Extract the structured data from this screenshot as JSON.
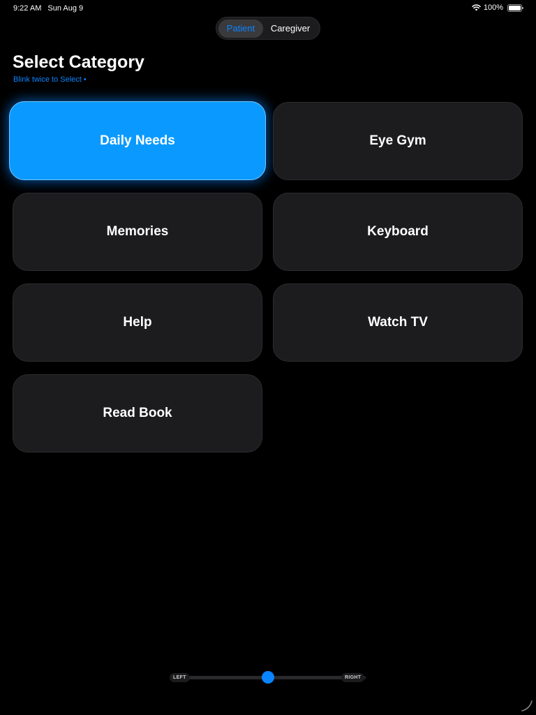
{
  "status_bar": {
    "time": "9:22 AM",
    "date": "Sun Aug 9",
    "battery": "100%"
  },
  "segmented_control": {
    "options": [
      {
        "label": "Patient",
        "selected": true
      },
      {
        "label": "Caregiver",
        "selected": false
      }
    ]
  },
  "header": {
    "title": "Select Category",
    "subtitle": "Blink twice to Select •"
  },
  "categories": [
    {
      "label": "Daily Needs",
      "selected": true
    },
    {
      "label": "Eye Gym",
      "selected": false
    },
    {
      "label": "Memories",
      "selected": false
    },
    {
      "label": "Keyboard",
      "selected": false
    },
    {
      "label": "Help",
      "selected": false
    },
    {
      "label": "Watch TV",
      "selected": false
    },
    {
      "label": "Read Book",
      "selected": false
    }
  ],
  "gaze_slider": {
    "left_label": "LEFT",
    "right_label": "RIGHT",
    "value": 0.5
  },
  "colors": {
    "background": "#000000",
    "accent": "#0a84ff",
    "selected_tile": "#0a9aff",
    "tile": "#1c1c1e"
  }
}
